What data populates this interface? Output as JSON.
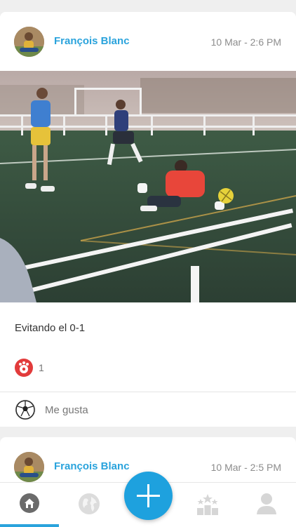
{
  "posts": [
    {
      "author": "François Blanc",
      "timestamp": "10 Mar - 2:6 PM",
      "caption": "Evitando el 0-1",
      "like_count": "1",
      "action_label": "Me gusta",
      "photo": "soccer-goalkeeper-save-photo"
    },
    {
      "author": "François Blanc",
      "timestamp": "10 Mar - 2:5 PM"
    }
  ],
  "tabs": [
    {
      "name": "home",
      "icon": "home-icon",
      "active": true
    },
    {
      "name": "explore",
      "icon": "globe-icon",
      "active": false
    },
    {
      "name": "create",
      "icon": "plus-icon",
      "active": false
    },
    {
      "name": "rankings",
      "icon": "stars-podium-icon",
      "active": false
    },
    {
      "name": "profile",
      "icon": "user-icon",
      "active": false
    }
  ],
  "colors": {
    "accent": "#2aa3dc",
    "fab": "#1ea1de",
    "like_badge": "#e23b3b",
    "background": "#efefef"
  }
}
